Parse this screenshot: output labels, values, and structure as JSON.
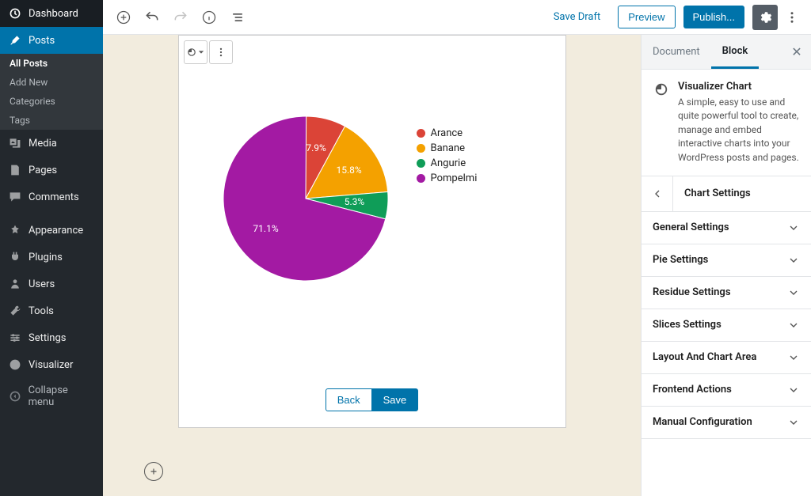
{
  "sidebar": {
    "dashboard": "Dashboard",
    "posts": "Posts",
    "subitems": [
      "All Posts",
      "Add New",
      "Categories",
      "Tags"
    ],
    "media": "Media",
    "pages": "Pages",
    "comments": "Comments",
    "appearance": "Appearance",
    "plugins": "Plugins",
    "users": "Users",
    "tools": "Tools",
    "settings": "Settings",
    "visualizer": "Visualizer",
    "collapse": "Collapse menu"
  },
  "topbar": {
    "save_draft": "Save Draft",
    "preview": "Preview",
    "publish": "Publish..."
  },
  "block": {
    "back": "Back",
    "save": "Save"
  },
  "panel": {
    "tab_document": "Document",
    "tab_block": "Block",
    "title": "Visualizer Chart",
    "blurb": "A simple, easy to use and quite powerful tool to create, manage and embed interactive charts into your WordPress posts and pages.",
    "section_heading": "Chart Settings",
    "sections": [
      "General Settings",
      "Pie Settings",
      "Residue Settings",
      "Slices Settings",
      "Layout And Chart Area",
      "Frontend Actions",
      "Manual Configuration"
    ]
  },
  "chart_data": {
    "type": "pie",
    "series": [
      {
        "name": "Arance",
        "value": 7.9,
        "color": "#db4437"
      },
      {
        "name": "Banane",
        "value": 15.8,
        "color": "#f4a100"
      },
      {
        "name": "Angurie",
        "value": 5.3,
        "color": "#0f9d58"
      },
      {
        "name": "Pompelmi",
        "value": 71.1,
        "color": "#a31aa3"
      }
    ],
    "labels_on_slices": [
      "7.9%",
      "15.8%",
      "5.3%",
      "71.1%"
    ],
    "first_slice_start_angle_deg": 0,
    "direction": "clockwise"
  }
}
